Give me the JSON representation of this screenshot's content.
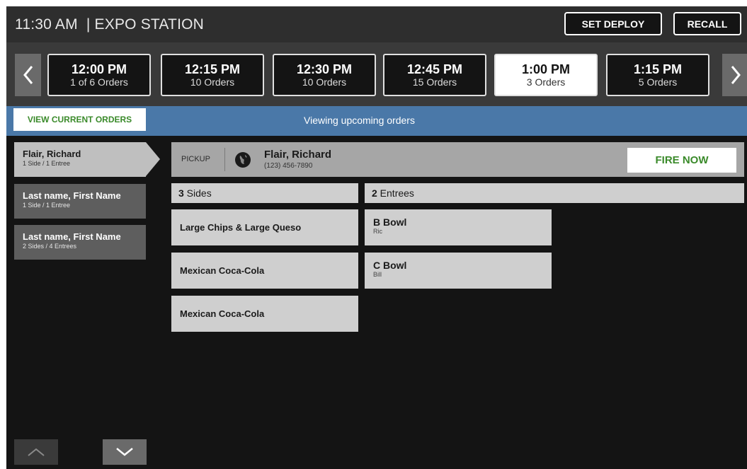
{
  "header": {
    "title": "11:30 AM  | EXPO STATION",
    "set_deploy_label": "SET DEPLOY",
    "recall_label": "RECALL"
  },
  "time_slots": [
    {
      "time": "12:00 PM",
      "count": "1 of 6 Orders",
      "active": false
    },
    {
      "time": "12:15 PM",
      "count": "10 Orders",
      "active": false
    },
    {
      "time": "12:30 PM",
      "count": "10 Orders",
      "active": false
    },
    {
      "time": "12:45 PM",
      "count": "15 Orders",
      "active": false
    },
    {
      "time": "1:00 PM",
      "count": "3 Orders",
      "active": true
    },
    {
      "time": "1:15 PM",
      "count": "5 Orders",
      "active": false
    }
  ],
  "info_bar": {
    "view_current_label": "VIEW CURRENT ORDERS",
    "status_text": "Viewing upcoming orders"
  },
  "customers": [
    {
      "name": "Flair, Richard",
      "detail": "1 Side / 1 Entree"
    },
    {
      "name": "Last name, First Name",
      "detail": "1 Side / 1 Entree"
    },
    {
      "name": "Last name, First Name",
      "detail": "2 Sides / 4 Entrees"
    }
  ],
  "order": {
    "type_label": "PICKUP",
    "customer_name": "Flair, Richard",
    "phone": "(123) 456-7890",
    "fire_now_label": "FIRE NOW"
  },
  "sides": {
    "count": "3",
    "label": " Sides",
    "items": [
      "Large Chips & Large Queso",
      "Mexican Coca-Cola",
      "Mexican Coca-Cola"
    ]
  },
  "entrees": {
    "count": "2",
    "label": " Entrees",
    "items": [
      {
        "name": "B Bowl",
        "note": "Ric"
      },
      {
        "name": "C Bowl",
        "note": "Bill"
      }
    ]
  },
  "colors": {
    "accent_green": "#3a8a2a",
    "info_bar_blue": "#4a78a8",
    "background": "#141414"
  },
  "icons": {
    "prev": "chevron-left-icon",
    "next": "chevron-right-icon",
    "customer": "globe-icon",
    "scroll_up": "chevron-up-icon",
    "scroll_down": "chevron-down-icon"
  }
}
